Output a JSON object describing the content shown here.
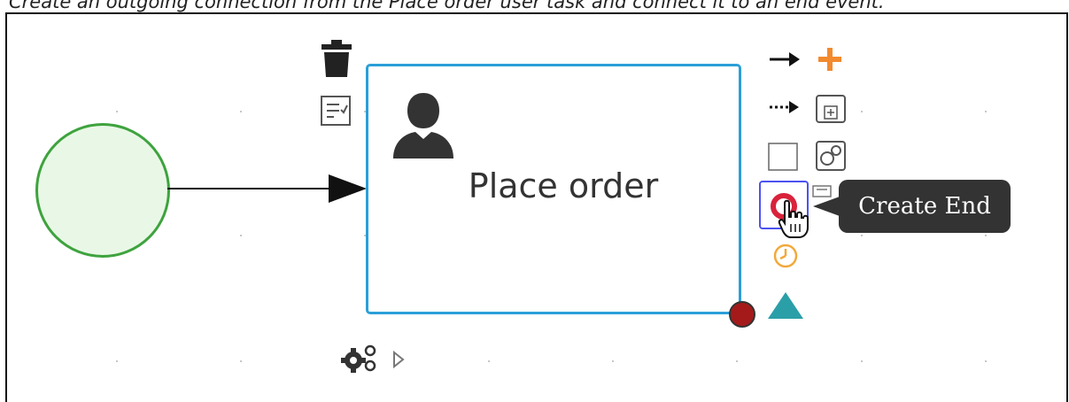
{
  "caption": "Create an outgoing connection from the Place order user task and connect it to an end event.",
  "task": {
    "label": "Place order",
    "icon": "user-icon"
  },
  "start_event": {
    "icon": "start-event-circle"
  },
  "palette": {
    "items": [
      {
        "name": "delete",
        "icon": "trash-icon"
      },
      {
        "name": "documentation",
        "icon": "form-icon"
      },
      {
        "name": "sequence-flow",
        "icon": "arrow-right-icon"
      },
      {
        "name": "add-node",
        "icon": "plus-icon"
      },
      {
        "name": "association",
        "icon": "dotted-arrow-icon"
      },
      {
        "name": "subprocess",
        "icon": "subprocess-icon"
      },
      {
        "name": "task",
        "icon": "task-icon"
      },
      {
        "name": "reusable-subprocess",
        "icon": "reusable-subprocess-icon"
      },
      {
        "name": "end-event",
        "icon": "end-event-icon"
      },
      {
        "name": "timer-event",
        "icon": "timer-icon"
      },
      {
        "name": "gateway",
        "icon": "triangle-icon"
      },
      {
        "name": "morph",
        "icon": "gears-icon"
      },
      {
        "name": "expand",
        "icon": "play-outline-icon"
      }
    ]
  },
  "tooltip": {
    "text": "Create End"
  },
  "colors": {
    "task_border": "#2a9fd8",
    "start_border": "#3ea33e",
    "start_fill": "#e9f8e6",
    "end_event": "#d9223b",
    "plus": "#f28a2e",
    "timer": "#f2a93b",
    "gateway": "#2b9fa8",
    "resize_handle": "#a41a1a",
    "selection": "#4c52f0",
    "tooltip_bg": "#333333"
  }
}
